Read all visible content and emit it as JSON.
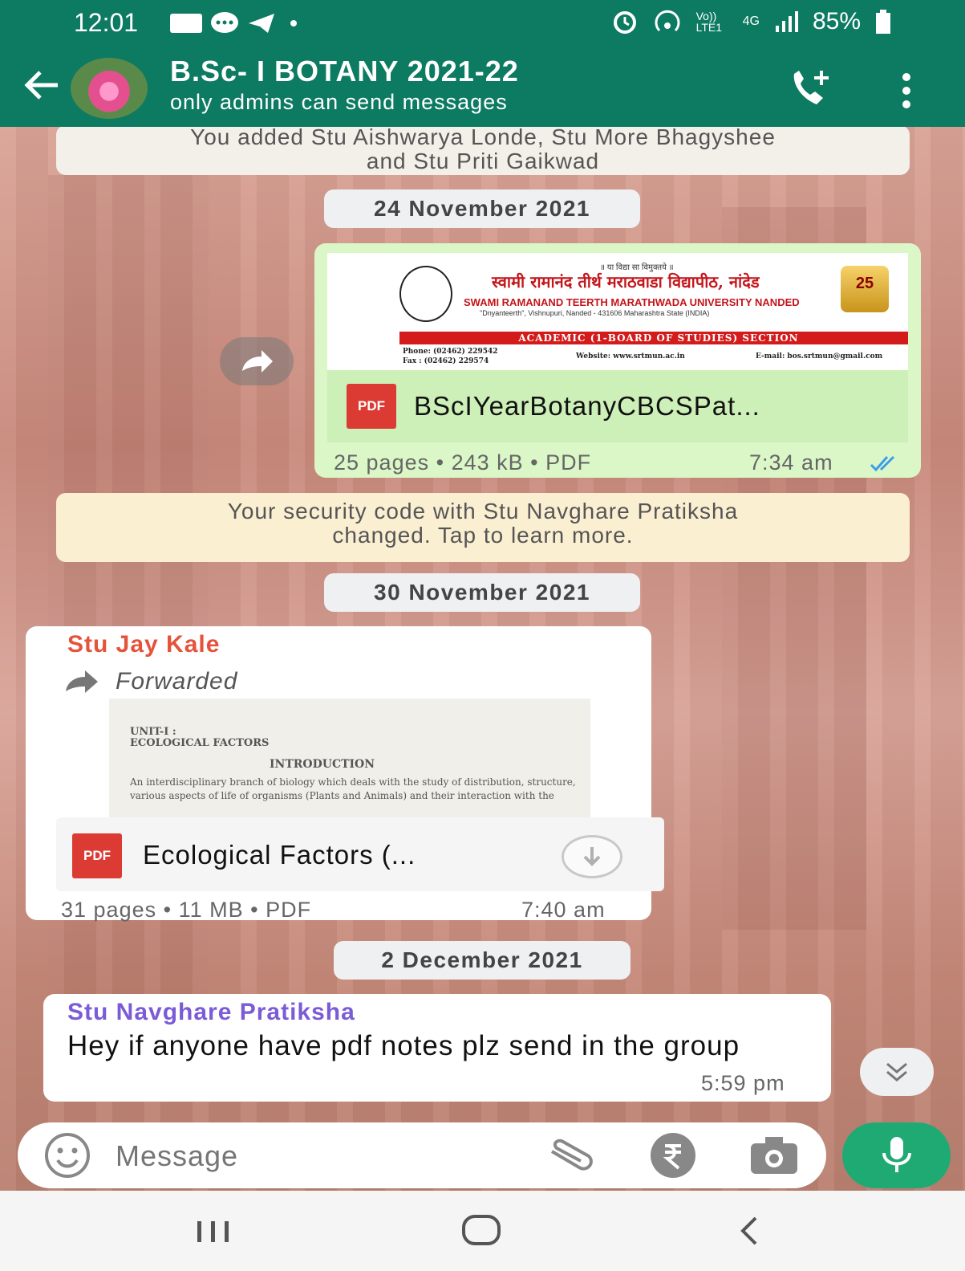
{
  "status_bar": {
    "time": "12:01",
    "battery": "85%",
    "network": "4G",
    "volte": "Vo)) LTE1"
  },
  "header": {
    "title": "B.Sc- I BOTANY 2021-22",
    "subtitle": "only admins can send messages"
  },
  "messages": {
    "system_added": "You added Stu Aishwarya Londe, Stu More Bhagyshee and Stu Priti Gaikwad",
    "date_1": "24 November 2021",
    "doc_out": {
      "thumb_tag": "॥ या विद्या सा विमुक्तये ॥",
      "thumb_hindi": "स्वामी रामानंद तीर्थ मराठवाडा विद्यापीठ, नांदेड",
      "thumb_university": "SWAMI RAMANAND TEERTH MARATHWADA UNIVERSITY NANDED",
      "thumb_address": "\"Dnyanteerth\", Vishnupuri, Nanded - 431606 Maharashtra State (INDIA)",
      "thumb_section": "ACADEMIC (1-BOARD OF STUDIES) SECTION",
      "thumb_phone": "Phone: (02462) 229542",
      "thumb_fax": "Fax : (02462) 229574",
      "thumb_website": "Website: www.srtmun.ac.in",
      "thumb_email": "E-mail: bos.srtmun@gmail.com",
      "thumb_badge": "25",
      "pdf_label": "PDF",
      "file_name": "BScIYearBotanyCBCSPat...",
      "pages": "25 pages",
      "size": "243 kB",
      "type": "PDF",
      "time": "7:34 am"
    },
    "system_security": "Your security code with Stu Navghare Pratiksha changed. Tap to learn more.",
    "date_2": "30 November 2021",
    "doc_in": {
      "sender": "Stu Jay Kale",
      "forwarded": "Forwarded",
      "thumb_unit": "UNIT-I :",
      "thumb_heading": "ECOLOGICAL FACTORS",
      "thumb_intro": "INTRODUCTION",
      "thumb_text": "An interdisciplinary branch of biology which deals with the study of distribution, structure, various aspects of life of organisms (Plants and Animals) and their interaction with the",
      "pdf_label": "PDF",
      "file_name": "Ecological Factors (...",
      "pages": "31 pages",
      "size": "11 MB",
      "type": "PDF",
      "time": "7:40 am"
    },
    "date_3": "2 December 2021",
    "text_in": {
      "sender": "Stu Navghare Pratiksha",
      "text": "Hey if anyone have pdf notes plz send in the group",
      "time": "5:59 pm"
    }
  },
  "composer": {
    "placeholder": "Message"
  },
  "colors": {
    "header_green": "#0d7a62",
    "outgoing_bubble": "#dbf7c8",
    "sender_jay": "#e5533b",
    "sender_navghare": "#7b5bd6",
    "mic_button": "#1faa73",
    "read_ticks": "#3b9ee8"
  },
  "icons": [
    "back-arrow-icon",
    "add-call-icon",
    "more-vert-icon",
    "forward-icon",
    "pdf-icon",
    "download-icon",
    "emoji-icon",
    "attach-icon",
    "rupee-icon",
    "camera-icon",
    "mic-icon",
    "scroll-down-icon",
    "recents-icon",
    "home-icon",
    "back-icon"
  ]
}
